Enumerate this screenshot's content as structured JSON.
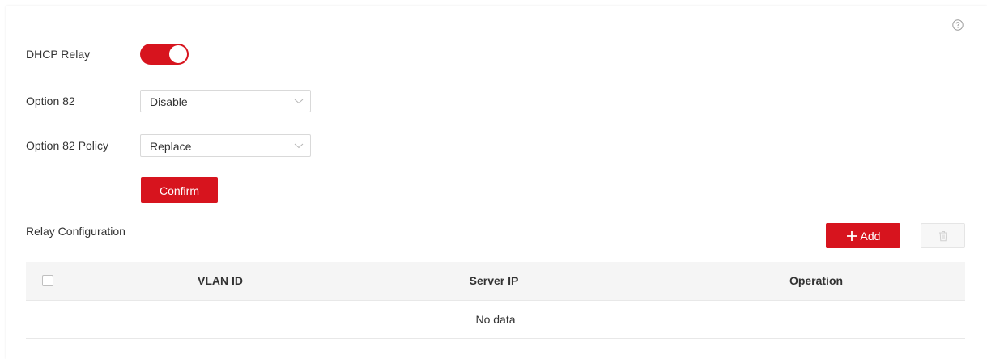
{
  "form": {
    "dhcp_relay_label": "DHCP Relay",
    "dhcp_relay_enabled": true,
    "option82_label": "Option 82",
    "option82_value": "Disable",
    "option82_policy_label": "Option 82 Policy",
    "option82_policy_value": "Replace",
    "confirm_label": "Confirm"
  },
  "relay": {
    "section_title": "Relay Configuration",
    "add_label": "Add",
    "columns": [
      "VLAN ID",
      "Server IP",
      "Operation"
    ],
    "empty_text": "No data"
  },
  "colors": {
    "accent": "#d7141e"
  },
  "icons": {
    "help": "help-icon",
    "chevron": "chevron-down-icon",
    "plus": "plus-icon",
    "trash": "trash-icon"
  }
}
